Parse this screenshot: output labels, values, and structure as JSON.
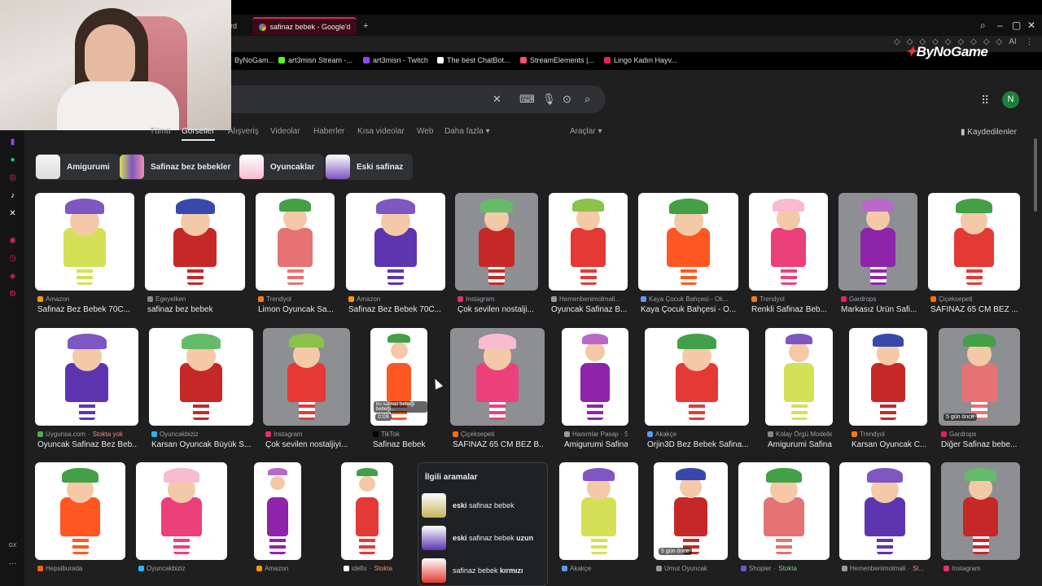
{
  "browser": {
    "tab_prev_label": "ard",
    "tab_active_label": "safinaz bebek - Google'da",
    "new_tab": "+",
    "bookmarks": [
      {
        "label": "ByNoGam...",
        "color": "#ffffff"
      },
      {
        "label": "art3misn Stream -...",
        "color": "#53fc18"
      },
      {
        "label": "art3misn - Twitch",
        "color": "#9146ff"
      },
      {
        "label": "The best ChatBot...",
        "color": "#ffffff"
      },
      {
        "label": "StreamElements |...",
        "color": "#ff4d6d"
      },
      {
        "label": "Lingo Kadın Hayv...",
        "color": "#e91e63"
      }
    ],
    "ext_label": "AI",
    "logo_text": "ByNoGame"
  },
  "search": {
    "account_initial": "N"
  },
  "nav": {
    "tabs": [
      "Tümü",
      "Görseller",
      "Alışveriş",
      "Videolar",
      "Haberler",
      "Kısa videolar",
      "Web",
      "Daha fazla"
    ],
    "tools": "Araçlar",
    "saved": "Kaydedilenler"
  },
  "chips": [
    "Amigurumi",
    "Safinaz bez bebekler",
    "Oyuncaklar",
    "Eski safinaz"
  ],
  "row1": [
    {
      "source": "Amazon",
      "title": "Safinaz Bez Bebek 70C...",
      "fav": "#ff9900"
    },
    {
      "source": "Egeyelken",
      "title": "safinaz bez bebek",
      "fav": "#888888"
    },
    {
      "source": "Trendyol",
      "title": "Limon Oyuncak Sa...",
      "fav": "#f27a1a"
    },
    {
      "source": "Amazon",
      "title": "Safinaz Bez Bebek 70C...",
      "fav": "#ff9900"
    },
    {
      "source": "Instagram",
      "title": "Çok sevilen nostalji...",
      "fav": "#e1306c"
    },
    {
      "source": "Hemenbenimolmali...",
      "title": "Oyuncak Safinaz B...",
      "fav": "#999999"
    },
    {
      "source": "Kaya Çocuk Bahçesi - Ok...",
      "title": "Kaya Çocuk Bahçesi - O...",
      "fav": "#5e97f6"
    },
    {
      "source": "Trendyol",
      "title": "Renkli Safinaz Beb...",
      "fav": "#f27a1a"
    },
    {
      "source": "Gardrops",
      "title": "Markasız Ürün Safi...",
      "fav": "#e91e63"
    },
    {
      "source": "Çiçeksepeti",
      "title": "SAFİNAZ 65 CM BEZ ...",
      "fav": "#ff6f00"
    }
  ],
  "row2": [
    {
      "source": "Uygunsa.com",
      "stock": "Stokta yok",
      "title": "Oyuncak Safinaz Bez Beb...",
      "fav": "#4caf50"
    },
    {
      "source": "Oyuncakbiziz",
      "title": "Karsan Oyuncak Büyük S...",
      "fav": "#29b6f6"
    },
    {
      "source": "Instagram",
      "title": "Çok sevilen nostaljiyi...",
      "fav": "#e1306c"
    },
    {
      "source": "TikTok",
      "title": "Safinaz Bebek Oy...",
      "fav": "#000000",
      "duration": "0:09",
      "overlay": "bu safinaz bebeği bebeği..."
    },
    {
      "source": "Çiçeksepeti",
      "title": "SAFİNAZ 65 CM BEZ B...",
      "fav": "#ff6f00"
    },
    {
      "source": "Hanımlar Pasajı · S...",
      "title": "Amigurumi Safinaz...",
      "fav": "#999999"
    },
    {
      "source": "Akakçe",
      "title": "Orjin3D Bez Bebek Safina...",
      "fav": "#5e97f6"
    },
    {
      "source": "Kolay Örgü Modelleri",
      "title": "Amigurumi Safinaz...",
      "fav": "#888888"
    },
    {
      "source": "Trendyol",
      "title": "Karsan Oyuncak C...",
      "fav": "#f27a1a"
    },
    {
      "source": "Gardrops",
      "title": "Diğer Safinaz bebe...",
      "fav": "#e91e63",
      "badge": "5 gün önce"
    }
  ],
  "row3": [
    {
      "source": "Hepsiburada",
      "fav": "#ff6000"
    },
    {
      "source": "Oyuncakbiziz",
      "fav": "#29b6f6"
    },
    {
      "source": "Amazon",
      "fav": "#ff9900"
    },
    {
      "source": "idefix",
      "stock": "Stokta yok",
      "fav": "#ffffff"
    },
    {
      "source": "Akakçe",
      "fav": "#5e97f6"
    },
    {
      "source": "Umut Oyuncak",
      "fav": "#999999",
      "badge": "5 gün önce"
    },
    {
      "source": "Shopier",
      "stock": "Stokta",
      "fav": "#6a5acd"
    },
    {
      "source": "Hemenbenimolmali",
      "stock": "St...",
      "fav": "#999999"
    },
    {
      "source": "Instagram",
      "fav": "#e1306c"
    }
  ],
  "related": {
    "title": "İlgili aramalar",
    "items": [
      {
        "bold": "eski",
        "rest": " safinaz bebek",
        "bold2": ""
      },
      {
        "bold": "eski",
        "rest": " safinaz bebek ",
        "bold2": "uzun"
      },
      {
        "bold": "",
        "rest": "safinaz bebek ",
        "bold2": "kırmızı"
      }
    ]
  },
  "sidebar_icons": [
    "twitch-icon",
    "whatsapp-icon",
    "instagram-icon",
    "tiktok-icon",
    "x-icon",
    "record-icon",
    "history-icon",
    "extensions-icon",
    "settings-icon",
    "gx-icon",
    "more-icon"
  ],
  "colors": {
    "accent": "#e0245e",
    "google_dark": "#1f1f1f"
  }
}
